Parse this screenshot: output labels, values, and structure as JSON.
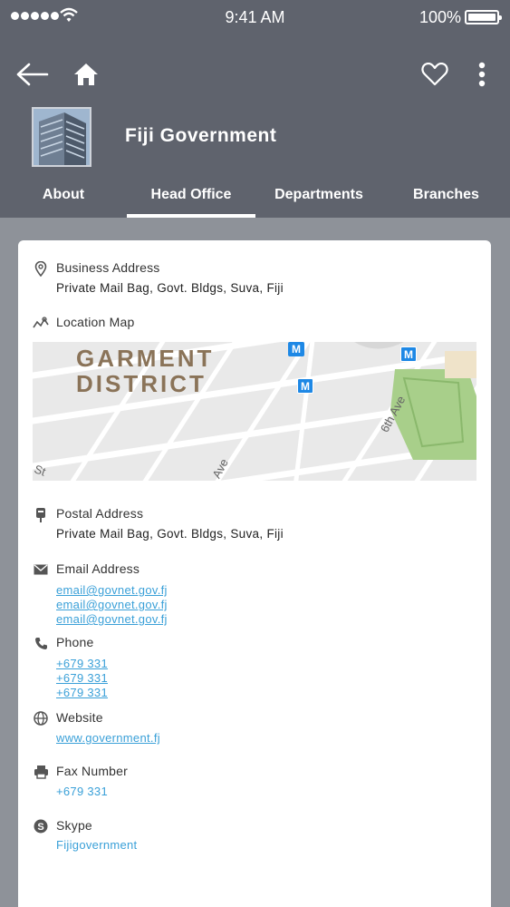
{
  "status_bar": {
    "time": "9:41 AM",
    "battery": "100%"
  },
  "header": {
    "title": "Fiji Government"
  },
  "tabs": [
    {
      "label": "About",
      "active": false
    },
    {
      "label": "Head Office",
      "active": true
    },
    {
      "label": "Departments",
      "active": false
    },
    {
      "label": "Branches",
      "active": false
    }
  ],
  "details": {
    "business_address": {
      "title": "Business Address",
      "value": "Private Mail Bag, Govt. Bldgs, Suva, Fiji"
    },
    "location_map": {
      "title": "Location Map",
      "map_district_line1": "GARMENT",
      "map_district_line2": "DISTRICT",
      "map_street_1": "6th Ave",
      "map_street_2": "Ave",
      "map_street_3": "St",
      "map_marker": "M"
    },
    "postal_address": {
      "title": "Postal Address",
      "value": "Private Mail Bag, Govt. Bldgs, Suva, Fiji"
    },
    "email": {
      "title": "Email Address",
      "values": [
        "email@govnet.gov.fj",
        "email@govnet.gov.fj",
        "email@govnet.gov.fj"
      ]
    },
    "phone": {
      "title": "Phone",
      "values": [
        "+679 331",
        "+679 331",
        "+679 331"
      ]
    },
    "website": {
      "title": "Website",
      "value": "www.government.fj"
    },
    "fax": {
      "title": "Fax Number",
      "value": "+679 331"
    },
    "skype": {
      "title": "Skype",
      "value": "Fijigovernment"
    }
  },
  "colors": {
    "header_bg": "#5f636d",
    "page_bg": "#8e9299",
    "link": "#3aa0d8",
    "park": "#a8cf8a",
    "map_marker": "#1e88e5"
  },
  "icons": [
    "wifi-icon",
    "battery-icon",
    "back-arrow-icon",
    "home-icon",
    "heart-icon",
    "more-vertical-icon",
    "location-pin-icon",
    "map-icon",
    "mailbox-icon",
    "envelope-icon",
    "phone-icon",
    "globe-icon",
    "printer-icon",
    "skype-icon"
  ]
}
